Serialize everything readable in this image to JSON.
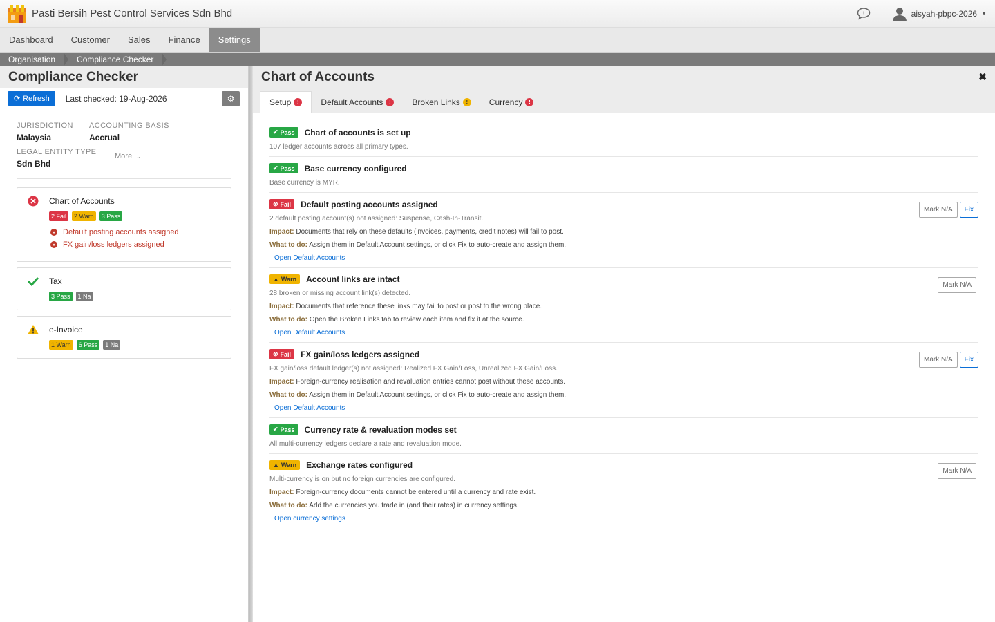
{
  "app": {
    "title": "Pasti Bersih Pest Control Services Sdn Bhd",
    "user": "aisyah-pbpc-2026"
  },
  "nav": [
    "Dashboard",
    "Customer",
    "Sales",
    "Finance",
    "Settings"
  ],
  "breadcrumb": [
    "Organisation",
    "Compliance Checker"
  ],
  "left": {
    "title": "Compliance Checker",
    "refresh_label": "Refresh",
    "last_checked": "Last checked: 19-Aug-2026",
    "meta": {
      "jurisdiction_label": "JURISDICTION",
      "jurisdiction": "Malaysia",
      "basis_label": "ACCOUNTING BASIS",
      "basis": "Accrual",
      "entity_label": "LEGAL ENTITY TYPE",
      "entity": "Sdn Bhd",
      "more": "More"
    },
    "cards": [
      {
        "title": "Chart of Accounts",
        "badges": [
          "2 Fail",
          "2 Warn",
          "3 Pass"
        ],
        "issues": [
          "Default posting accounts assigned",
          "FX gain/loss ledgers assigned"
        ]
      },
      {
        "title": "Tax",
        "badges": [
          "3 Pass",
          "1 Na"
        ]
      },
      {
        "title": "e-Invoice",
        "badges": [
          "1 Warn",
          "6 Pass",
          "1 Na"
        ]
      }
    ]
  },
  "right": {
    "title": "Chart of Accounts",
    "tabs": [
      "Setup",
      "Default Accounts",
      "Broken Links",
      "Currency"
    ],
    "labels": {
      "pass": "Pass",
      "fail": "Fail",
      "warn": "Warn",
      "impact": "Impact:",
      "todo": "What to do:",
      "mark_na": "Mark N/A",
      "fix": "Fix"
    },
    "checks": [
      {
        "title": "Chart of accounts is set up",
        "desc": "107 ledger accounts across all primary types."
      },
      {
        "title": "Base currency configured",
        "desc": "Base currency is MYR."
      },
      {
        "title": "Default posting accounts assigned",
        "desc": "2 default posting account(s) not assigned: Suspense, Cash-In-Transit.",
        "impact": "Documents that rely on these defaults (invoices, payments, credit notes) will fail to post.",
        "todo": "Assign them in Default Account settings, or click Fix to auto-create and assign them.",
        "link": "Open Default Accounts"
      },
      {
        "title": "Account links are intact",
        "desc": "28 broken or missing account link(s) detected.",
        "impact": "Documents that reference these links may fail to post or post to the wrong place.",
        "todo": "Open the Broken Links tab to review each item and fix it at the source.",
        "link": "Open Default Accounts"
      },
      {
        "title": "FX gain/loss ledgers assigned",
        "desc": "FX gain/loss default ledger(s) not assigned: Realized FX Gain/Loss, Unrealized FX Gain/Loss.",
        "impact": "Foreign-currency realisation and revaluation entries cannot post without these accounts.",
        "todo": "Assign them in Default Account settings, or click Fix to auto-create and assign them.",
        "link": "Open Default Accounts"
      },
      {
        "title": "Currency rate & revaluation modes set",
        "desc": "All multi-currency ledgers declare a rate and revaluation mode."
      },
      {
        "title": "Exchange rates configured",
        "desc": "Multi-currency is on but no foreign currencies are configured.",
        "impact": "Foreign-currency documents cannot be entered until a currency and rate exist.",
        "todo": "Add the currencies you trade in (and their rates) in currency settings.",
        "link": "Open currency settings"
      }
    ]
  }
}
